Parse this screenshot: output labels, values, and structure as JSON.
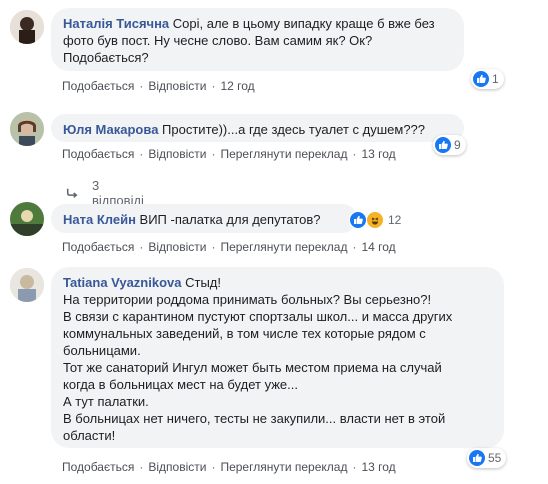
{
  "comments": [
    {
      "author": "Наталія Тисячна",
      "text_lines": [
        " Сорі, але в цьому випадку краще б вже без",
        "фото був пост. Ну чесне слово. Вам самим як? Ок?",
        "Подобається?"
      ],
      "like_label": "Подобається",
      "reply_label": "Відповісти",
      "time": "12 год",
      "reaction_count": "1"
    },
    {
      "author": "Юля Макарова",
      "text": " Простите))...а где здесь туалет с душем???",
      "like_label": "Подобається",
      "reply_label": "Відповісти",
      "translate_label": "Переглянути переклад",
      "time": "13 год",
      "reaction_count": "9",
      "replies_label": "3 відповіді"
    },
    {
      "author": "Ната Клейн",
      "text": " ВИП -палатка для депутатов?",
      "like_label": "Подобається",
      "reply_label": "Відповісти",
      "translate_label": "Переглянути переклад",
      "time": "14 год",
      "reaction_count": "12"
    },
    {
      "author": "Tatiana Vyaznikova",
      "first_line": " Стыд!",
      "text_lines": [
        "На территории роддома принимать больных? Вы серьезно?!",
        "В связи с карантином пустуют спортзалы школ... и масса других",
        "коммунальных заведений, в том числе тех которые рядом с",
        "больницами.",
        "Тот же санаторий Ингул может быть местом приема на случай",
        "когда в больницах мест на будет уже...",
        "А тут палатки.",
        "В больницах нет ничего, тесты не закупили... власти нет в этой",
        "области!"
      ],
      "like_label": "Подобається",
      "reply_label": "Відповісти",
      "translate_label": "Переглянути переклад",
      "time": "13 год",
      "reaction_count": "55"
    }
  ],
  "colors": {
    "author": "#385898",
    "bubble": "#f2f3f5",
    "like": "#1877f2",
    "haha": "#f7b125"
  }
}
